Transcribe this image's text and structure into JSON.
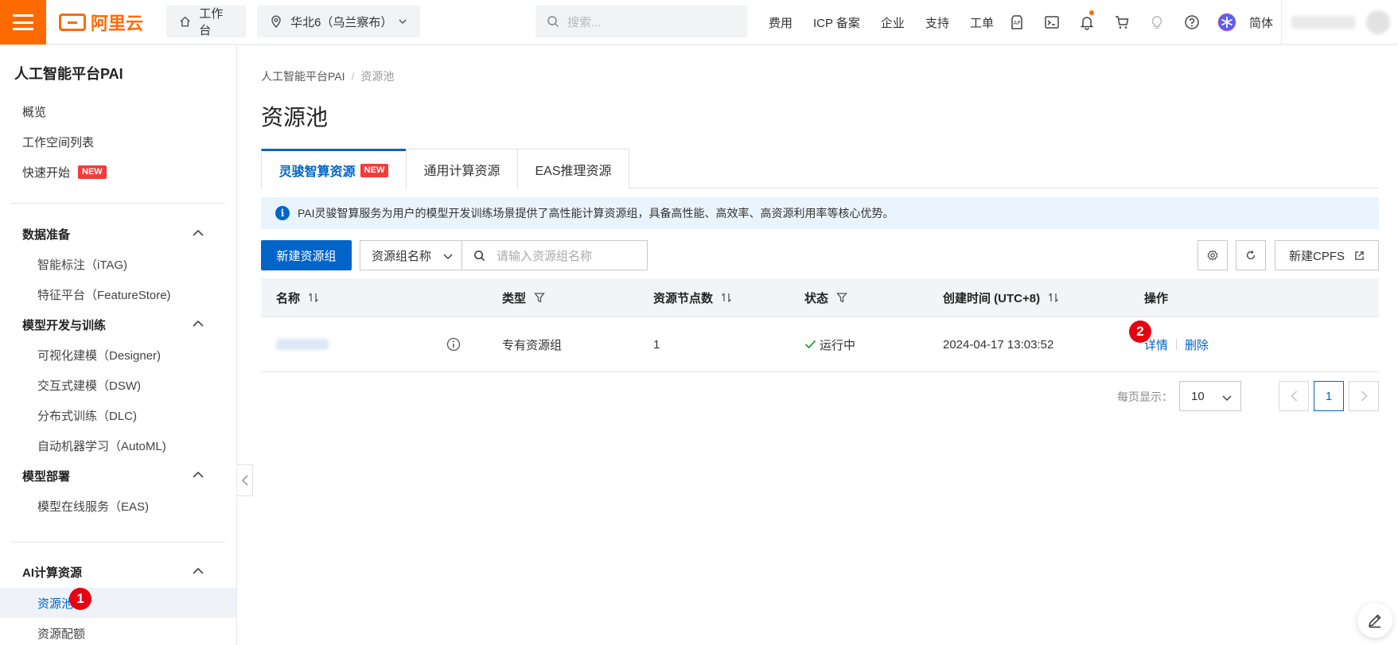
{
  "brand": {
    "logo_text": "阿里云",
    "accent": "#ff6a00"
  },
  "topbar": {
    "workbench": "工作台",
    "region": "华北6（乌兰察布）",
    "search_placeholder": "搜索...",
    "links": [
      "费用",
      "ICP 备案",
      "企业",
      "支持",
      "工单"
    ],
    "icons": [
      "app-icon",
      "terminal-icon",
      "bell-icon",
      "cart-icon",
      "bulb-icon",
      "help-icon",
      "assistant-icon"
    ],
    "lang": "简体"
  },
  "sidebar": {
    "title": "人工智能平台PAI",
    "top_items": [
      "概览",
      "工作空间列表",
      "快速开始"
    ],
    "new_badge": "NEW",
    "groups": [
      {
        "label": "数据准备",
        "items": [
          "智能标注（iTAG)",
          "特征平台（FeatureStore)"
        ]
      },
      {
        "label": "模型开发与训练",
        "items": [
          "可视化建模（Designer)",
          "交互式建模（DSW)",
          "分布式训练（DLC)",
          "自动机器学习（AutoML)"
        ]
      },
      {
        "label": "模型部署",
        "items": [
          "模型在线服务（EAS)"
        ]
      },
      {
        "label": "AI计算资源",
        "items": [
          "资源池",
          "资源配额"
        ]
      }
    ],
    "active_item": "资源池"
  },
  "steps": {
    "one": "1",
    "two": "2"
  },
  "breadcrumb": {
    "root": "人工智能平台PAI",
    "sep": "/",
    "current": "资源池"
  },
  "page_title": "资源池",
  "tabs": [
    {
      "label": "灵骏智算资源",
      "badge": "NEW",
      "active": true
    },
    {
      "label": "通用计算资源",
      "active": false
    },
    {
      "label": "EAS推理资源",
      "active": false
    }
  ],
  "notice": "PAI灵骏智算服务为用户的模型开发训练场景提供了高性能计算资源组，具备高性能、高效率、高资源利用率等核心优势。",
  "toolbar": {
    "create_label": "新建资源组",
    "filter_field": "资源组名称",
    "search_placeholder": "请输入资源组名称",
    "cpfs_label": "新建CPFS"
  },
  "table": {
    "columns": [
      "名称",
      "类型",
      "资源节点数",
      "状态",
      "创建时间 (UTC+8)",
      "操作"
    ],
    "rows": [
      {
        "type": "专有资源组",
        "nodes": "1",
        "status": "运行中",
        "created": "2024-04-17 13:03:52",
        "actions": [
          "详情",
          "删除"
        ]
      }
    ]
  },
  "pagination": {
    "label": "每页显示：",
    "page_size": "10",
    "current_page": "1"
  }
}
